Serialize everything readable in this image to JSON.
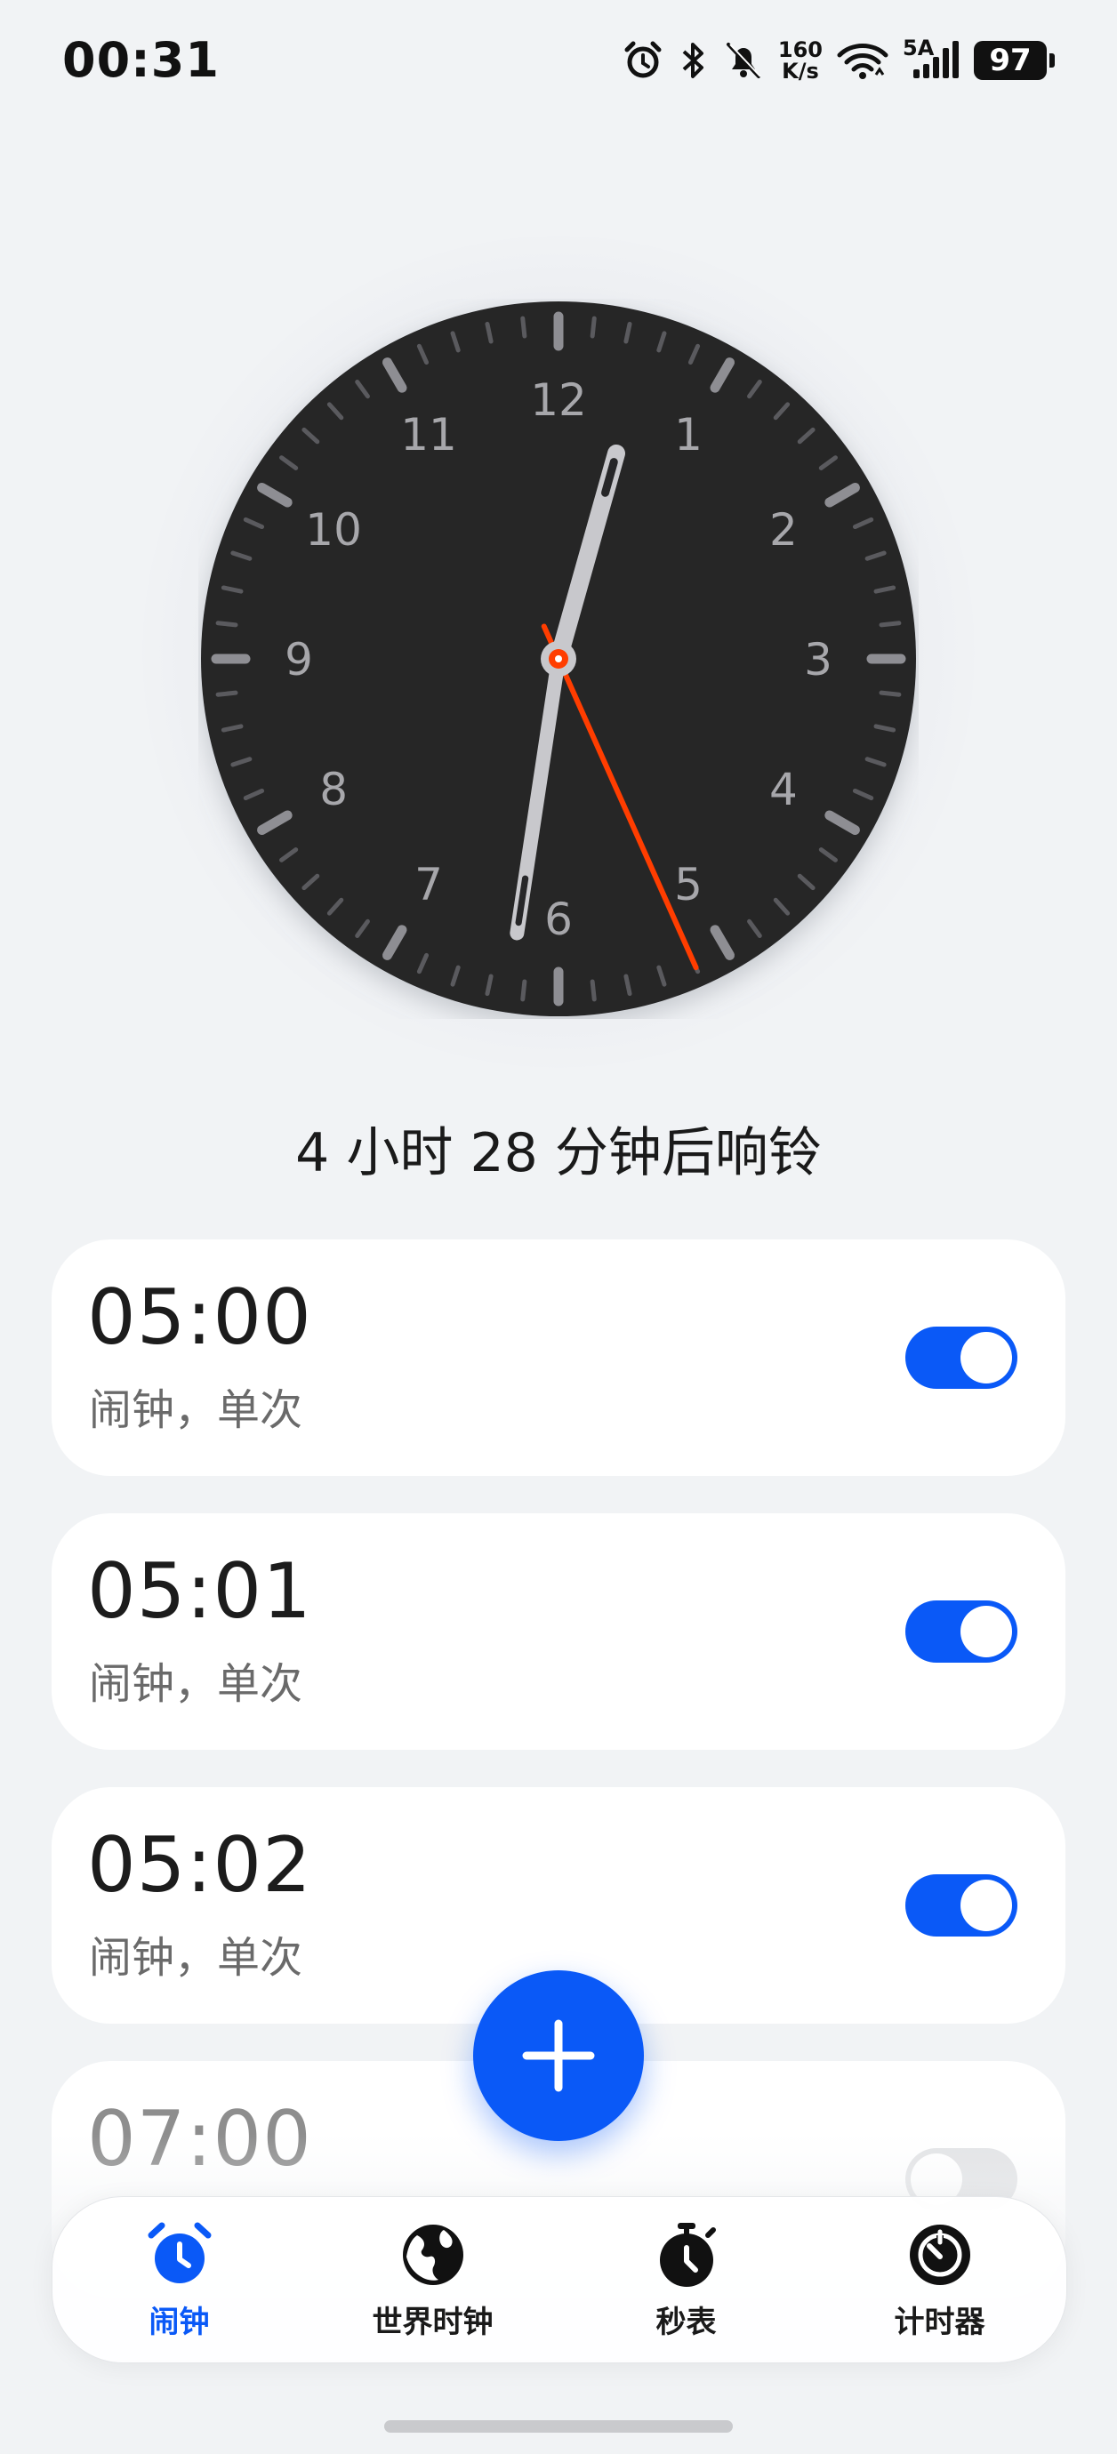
{
  "status_bar": {
    "time": "00:31",
    "net_speed_value": "160",
    "net_speed_unit": "K/s",
    "network_label": "5A",
    "battery": "97",
    "icons": [
      "alarm-clock-icon",
      "bluetooth-icon",
      "mute-bell-icon",
      "wifi-icon",
      "signal-icon",
      "battery-icon"
    ]
  },
  "clock": {
    "numerals": [
      "12",
      "1",
      "2",
      "3",
      "4",
      "5",
      "6",
      "7",
      "8",
      "9",
      "10",
      "11"
    ],
    "hour": 0,
    "minute": 31,
    "second": 26,
    "face_color": "#262628",
    "second_hand_color": "#ff3d00"
  },
  "next_alarm_text": "4 小时 28 分钟后响铃",
  "alarms": [
    {
      "time": "05:00",
      "label": "闹钟，单次",
      "enabled": true
    },
    {
      "time": "05:01",
      "label": "闹钟，单次",
      "enabled": true
    },
    {
      "time": "05:02",
      "label": "闹钟，单次",
      "enabled": true
    },
    {
      "time": "07:00",
      "label": "",
      "enabled": false
    }
  ],
  "add_button_icon": "plus-icon",
  "tabs": [
    {
      "label": "闹钟",
      "icon": "alarm-clock-icon",
      "active": true
    },
    {
      "label": "世界时钟",
      "icon": "globe-icon",
      "active": false
    },
    {
      "label": "秒表",
      "icon": "stopwatch-icon",
      "active": false
    },
    {
      "label": "计时器",
      "icon": "timer-icon",
      "active": false
    }
  ],
  "colors": {
    "accent": "#0a59f7",
    "background": "#f1f3f5",
    "card": "#ffffff"
  }
}
